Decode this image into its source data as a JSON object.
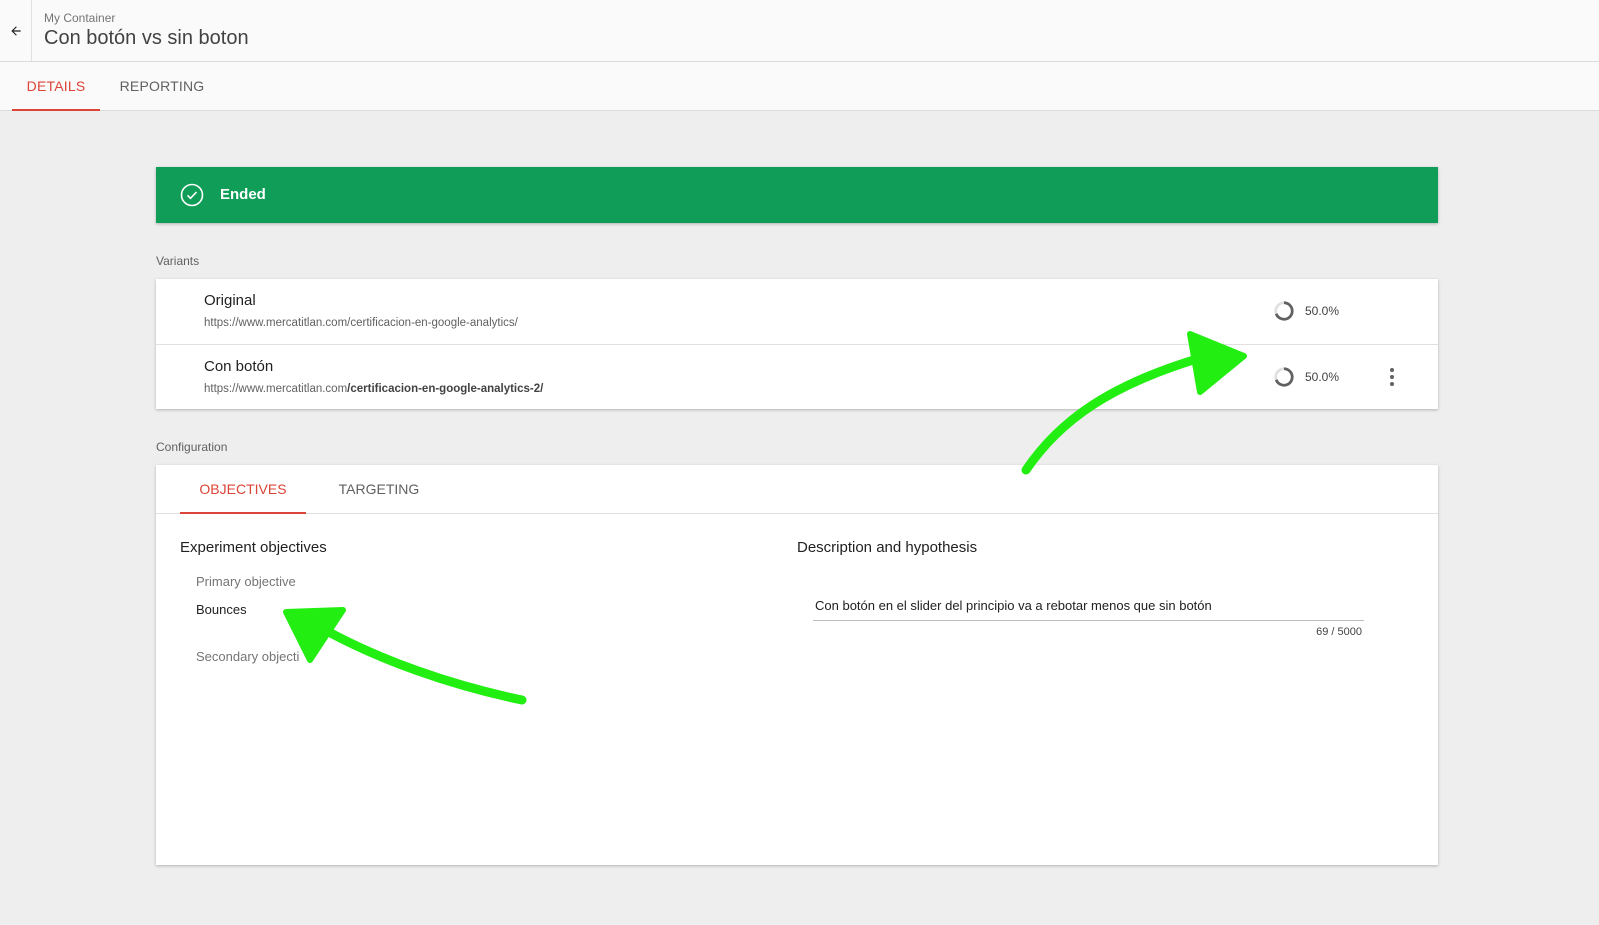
{
  "header": {
    "breadcrumb": "My Container",
    "title": "Con botón vs sin boton"
  },
  "tabs": [
    {
      "label": "DETAILS",
      "active": true
    },
    {
      "label": "REPORTING",
      "active": false
    }
  ],
  "status": {
    "label": "Ended",
    "color": "#0f9d58"
  },
  "variants": {
    "section_label": "Variants",
    "items": [
      {
        "name": "Original",
        "url": "https://www.mercatitlan.com/certificacion-en-google-analytics/",
        "url_base": "https://www.mercatitlan.com",
        "url_path": "/certificacion-en-google-analytics/",
        "weight": "50.0%",
        "has_menu": false
      },
      {
        "name": "Con botón",
        "url": "https://www.mercatitlan.com/certificacion-en-google-analytics-2/",
        "url_base": "https://www.mercatitlan.com",
        "url_path": "/certificacion-en-google-analytics-2/",
        "weight": "50.0%",
        "has_menu": true
      }
    ]
  },
  "configuration": {
    "section_label": "Configuration",
    "tabs": [
      {
        "label": "OBJECTIVES",
        "active": true
      },
      {
        "label": "TARGETING",
        "active": false
      }
    ],
    "objectives": {
      "title": "Experiment objectives",
      "primary_label": "Primary objective",
      "primary_value": "Bounces",
      "secondary_label": "Secondary objecti"
    },
    "description": {
      "title": "Description and hypothesis",
      "text": "Con botón en el slider del principio va a rebotar menos que sin botón",
      "counter": "69 / 5000"
    }
  },
  "colors": {
    "accent": "#db4437",
    "status_green": "#0f9d58",
    "annotation": "#22ee11"
  },
  "icons": {
    "back": "arrow-back-icon",
    "status": "check-circle-icon",
    "weight": "traffic-weight-ring-icon",
    "menu": "more-vert-icon"
  }
}
